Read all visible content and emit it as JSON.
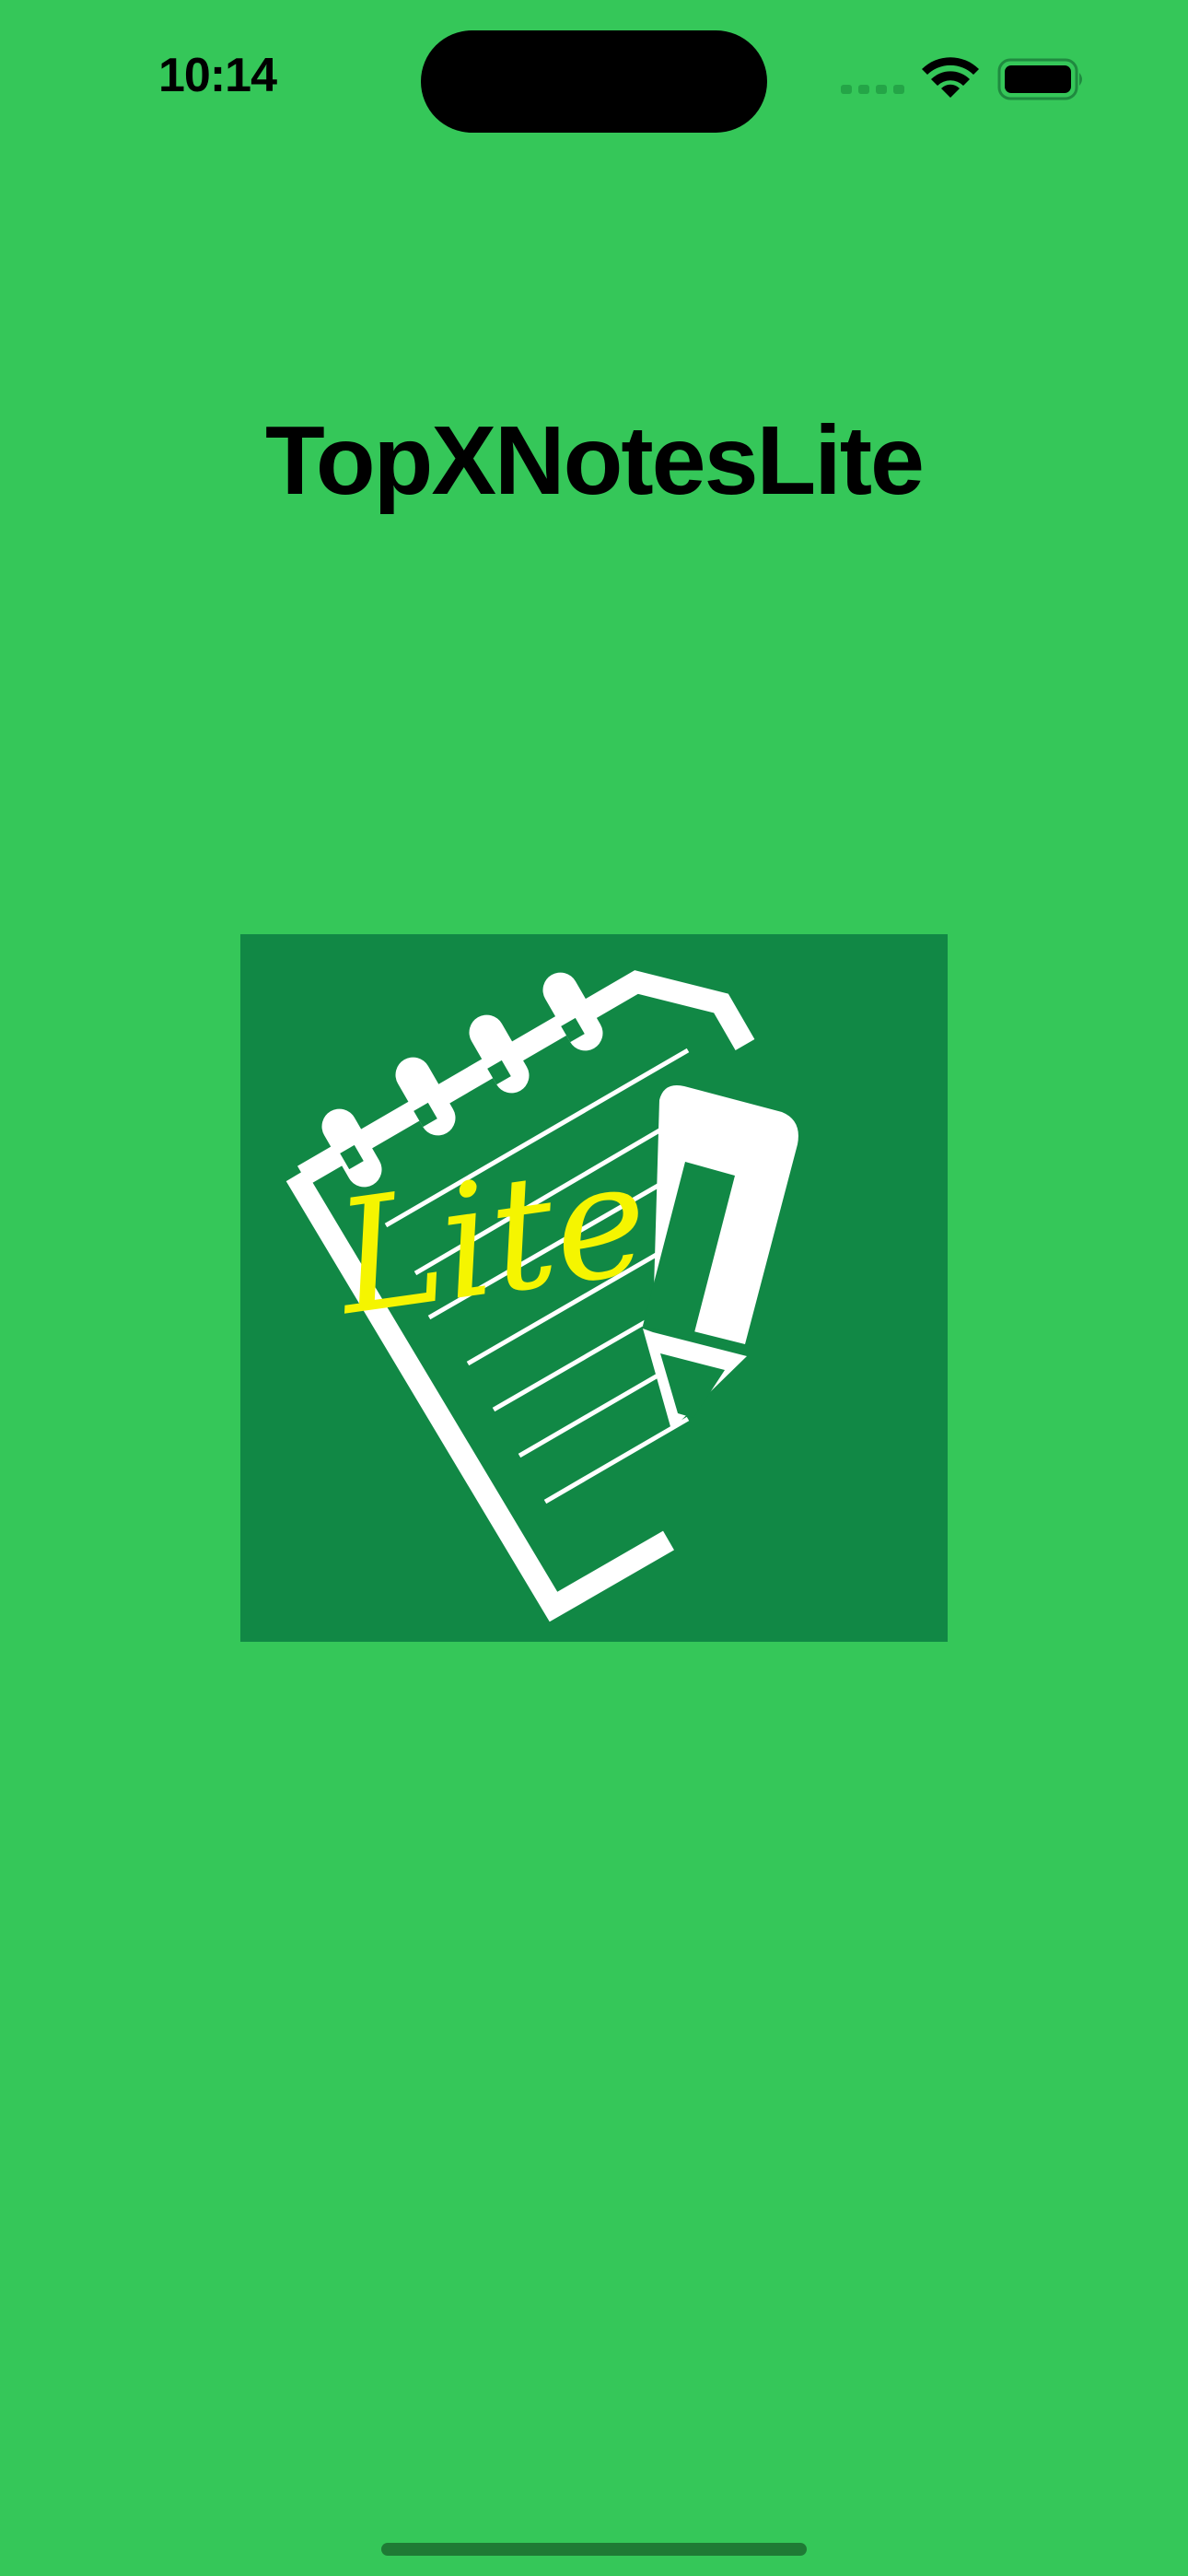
{
  "status_bar": {
    "time": "10:14",
    "icons": [
      "cellular-signal-icon",
      "wifi-icon",
      "battery-icon"
    ]
  },
  "app": {
    "title": "TopXNotesLite",
    "logo": {
      "icon": "notepad-pencil-logo",
      "text": "Lite",
      "background_color": "#118845",
      "accent_color": "#f5f500"
    }
  },
  "colors": {
    "background": "#35c759",
    "logo_background": "#118845",
    "logo_lines": "#ffffff",
    "logo_text": "#f5f500"
  }
}
